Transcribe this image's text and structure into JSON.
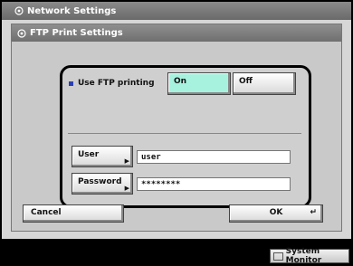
{
  "window": {
    "title": "Network Settings"
  },
  "panel": {
    "title": "FTP Print Settings"
  },
  "ftp": {
    "label": "Use FTP printing",
    "on_label": "On",
    "off_label": "Off",
    "selected": "On"
  },
  "user": {
    "button_label": "User",
    "value": "user"
  },
  "password": {
    "button_label": "Password",
    "value": "********"
  },
  "footer": {
    "cancel_label": "Cancel",
    "ok_label": "OK"
  },
  "taskbar": {
    "system_monitor_label": "System Monitor"
  },
  "colors": {
    "selected_button": "#a7f1df",
    "bullet": "#2b3fb5"
  }
}
